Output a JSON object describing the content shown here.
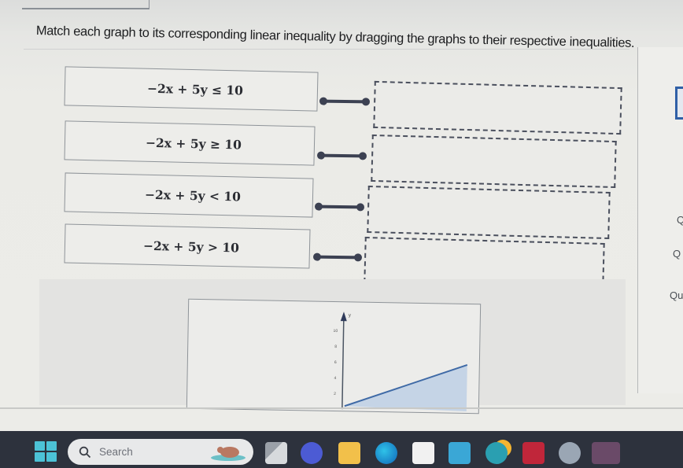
{
  "instruction": "Match each graph to its corresponding linear inequality by dragging the graphs to their respective inequalities.",
  "inequalities": [
    {
      "lhs": "−2x + 5y",
      "op": "≤",
      "rhs": "10",
      "text": "−2x  +  5y  ≤  10"
    },
    {
      "lhs": "−2x + 5y",
      "op": "≥",
      "rhs": "10",
      "text": "−2x  +  5y  ≥  10"
    },
    {
      "lhs": "−2x + 5y",
      "op": "<",
      "rhs": "10",
      "text": "−2x  +  5y  <  10"
    },
    {
      "lhs": "−2x + 5y",
      "op": ">",
      "rhs": "10",
      "text": "−2x  +  5y  >  10"
    }
  ],
  "drop_zones": [
    {
      "label": "",
      "state": "empty"
    },
    {
      "label": "",
      "state": "empty"
    },
    {
      "label": "",
      "state": "empty"
    },
    {
      "label": "",
      "state": "empty"
    }
  ],
  "right_panel": {
    "labels": [
      "Q",
      "Q",
      "Qu"
    ]
  },
  "draggable_graph": {
    "y_axis_label": "y",
    "y_tick_labels": [
      "10",
      "8",
      "6",
      "4",
      "2"
    ],
    "boundary_line": "solid",
    "shaded_region": "below line",
    "fill_color": "#c5d4e6",
    "line_color": "#3f6aa6"
  },
  "taskbar": {
    "search_label": "Search",
    "apps": [
      "start",
      "search",
      "task-view",
      "teams-meet",
      "file-explorer",
      "edge",
      "microsoft-store",
      "mdp",
      "support-app",
      "mcafee",
      "settings",
      "word"
    ]
  }
}
